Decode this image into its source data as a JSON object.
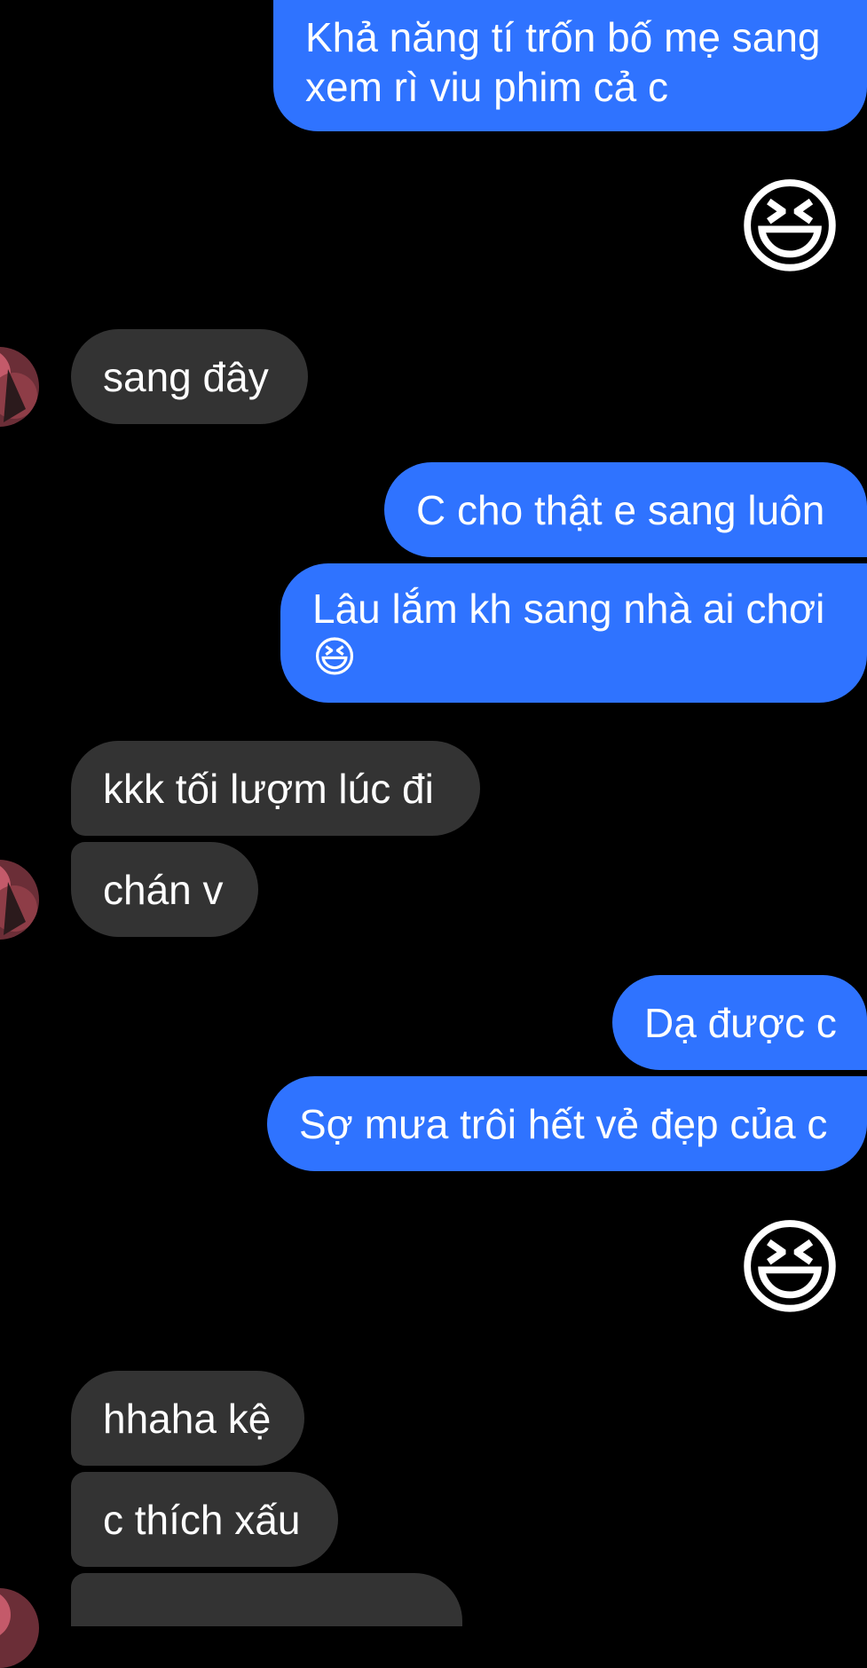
{
  "conversation": {
    "messages": [
      {
        "text_line1": "Khả năng tí trốn bố mẹ sang",
        "text_line2": "xem rì viu phim cả c"
      },
      {
        "emoji": "😆"
      },
      {
        "text": "sang đây"
      },
      {
        "text": "C cho thật e sang luôn"
      },
      {
        "text": "Lâu lắm kh sang nhà ai chơi",
        "emoji": "😆"
      },
      {
        "text": "kkk tối lượm lúc đi"
      },
      {
        "text": "chán v"
      },
      {
        "text": "Dạ được c"
      },
      {
        "text": "Sợ mưa trôi hết vẻ đẹp của c"
      },
      {
        "emoji": "😆"
      },
      {
        "text": "hhaha kệ"
      },
      {
        "text": "c thích xấu"
      }
    ]
  },
  "colors": {
    "background": "#000000",
    "outgoing_bubble": "#2f73ff",
    "incoming_bubble": "#333333",
    "text": "#ffffff"
  },
  "icons": {
    "avatar": "contact-avatar",
    "reaction": "grinning-squinting-face-emoji"
  }
}
